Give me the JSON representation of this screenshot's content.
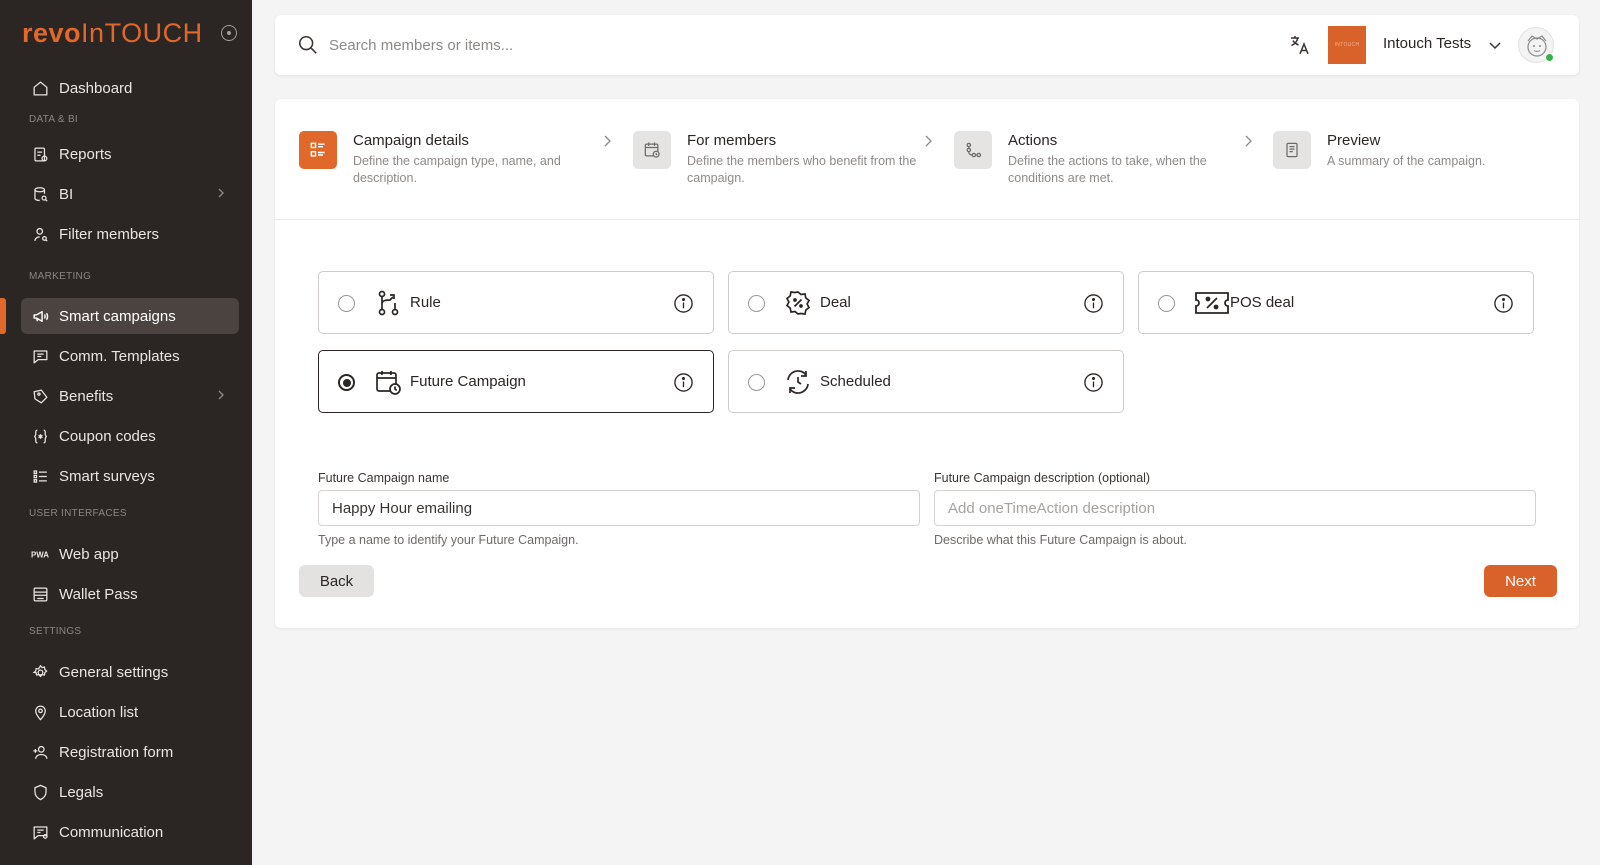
{
  "brand": {
    "name_bold": "revo",
    "name_light": "InTOUCH"
  },
  "sidebar": {
    "items": [
      {
        "label": "Dashboard"
      },
      {
        "label": "Reports"
      },
      {
        "label": "BI"
      },
      {
        "label": "Filter members"
      },
      {
        "label": "Smart campaigns"
      },
      {
        "label": "Comm. Templates"
      },
      {
        "label": "Benefits"
      },
      {
        "label": "Coupon codes"
      },
      {
        "label": "Smart surveys"
      },
      {
        "label": "Web app"
      },
      {
        "label": "Wallet Pass"
      },
      {
        "label": "General settings"
      },
      {
        "label": "Location list"
      },
      {
        "label": "Registration form"
      },
      {
        "label": "Legals"
      },
      {
        "label": "Communication"
      }
    ],
    "sections": [
      "DATA & BI",
      "MARKETING",
      "USER INTERFACES",
      "SETTINGS"
    ],
    "active_item": "Smart campaigns"
  },
  "topbar": {
    "search_placeholder": "Search members or items...",
    "org_logo_text": "INTOUCH",
    "org_name": "Intouch Tests"
  },
  "stepper": [
    {
      "title": "Campaign details",
      "desc": "Define the campaign type, name, and description.",
      "active": true
    },
    {
      "title": "For members",
      "desc": "Define the members who benefit from the campaign."
    },
    {
      "title": "Actions",
      "desc": "Define the actions to take, when the conditions are met."
    },
    {
      "title": "Preview",
      "desc": "A summary of the campaign."
    }
  ],
  "campaign_types": [
    {
      "label": "Rule",
      "icon": "branch-icon"
    },
    {
      "label": "Deal",
      "icon": "percent-badge-icon"
    },
    {
      "label": "POS deal",
      "icon": "ticket-percent-icon"
    },
    {
      "label": "Future Campaign",
      "icon": "calendar-clock-icon",
      "selected": true
    },
    {
      "label": "Scheduled",
      "icon": "refresh-clock-icon"
    }
  ],
  "form": {
    "name_label": "Future Campaign name",
    "name_value": "Happy Hour emailing",
    "name_help": "Type a name to identify your Future Campaign.",
    "desc_label": "Future Campaign description (optional)",
    "desc_placeholder": "Add oneTimeAction description",
    "desc_help": "Describe what this Future Campaign is about."
  },
  "buttons": {
    "back": "Back",
    "next": "Next"
  },
  "colors": {
    "accent": "#e0682a",
    "sidebar_bg": "#2b2523",
    "online": "#35b34a"
  }
}
